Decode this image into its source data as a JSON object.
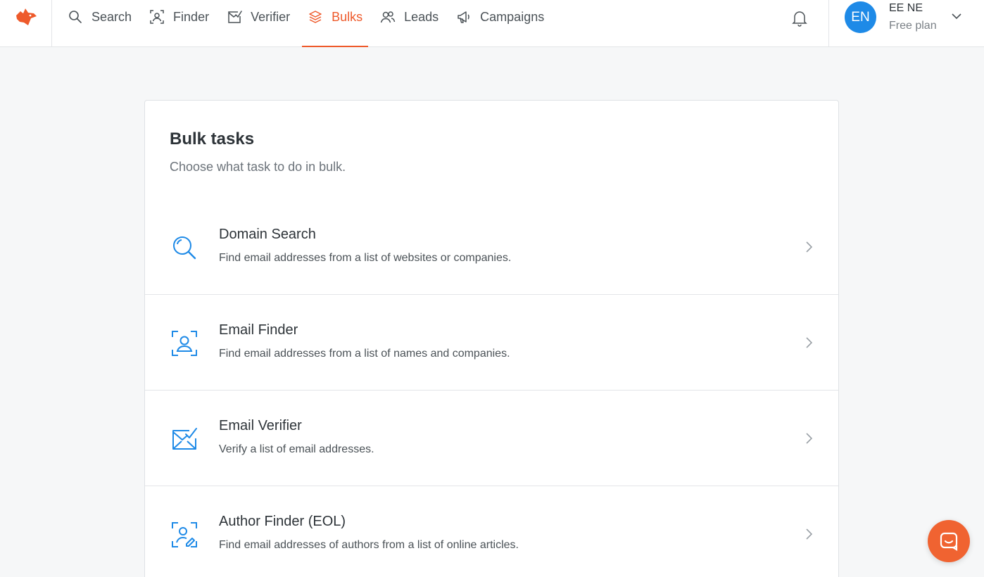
{
  "nav": {
    "items": [
      {
        "label": "Search",
        "icon": "search-icon",
        "active": false
      },
      {
        "label": "Finder",
        "icon": "finder-icon",
        "active": false
      },
      {
        "label": "Verifier",
        "icon": "verifier-icon",
        "active": false
      },
      {
        "label": "Bulks",
        "icon": "bulks-icon",
        "active": true
      },
      {
        "label": "Leads",
        "icon": "leads-icon",
        "active": false
      },
      {
        "label": "Campaigns",
        "icon": "campaigns-icon",
        "active": false
      }
    ]
  },
  "account": {
    "initials": "EN",
    "name": "EE NE",
    "plan": "Free plan",
    "avatar_color": "#1e8ae7"
  },
  "page": {
    "title": "Bulk tasks",
    "subtitle": "Choose what task to do in bulk."
  },
  "tasks": [
    {
      "name": "Domain Search",
      "description": "Find email addresses from a list of websites or companies.",
      "icon": "magnifier-icon"
    },
    {
      "name": "Email Finder",
      "description": "Find email addresses from a list of names and companies.",
      "icon": "person-frame-icon"
    },
    {
      "name": "Email Verifier",
      "description": "Verify a list of email addresses.",
      "icon": "envelope-check-icon"
    },
    {
      "name": "Author Finder (EOL)",
      "description": "Find email addresses of authors from a list of online articles.",
      "icon": "author-pen-icon"
    }
  ],
  "colors": {
    "accent": "#ee5a2b",
    "icon_blue": "#1e8ae7",
    "chat": "#f06331"
  }
}
